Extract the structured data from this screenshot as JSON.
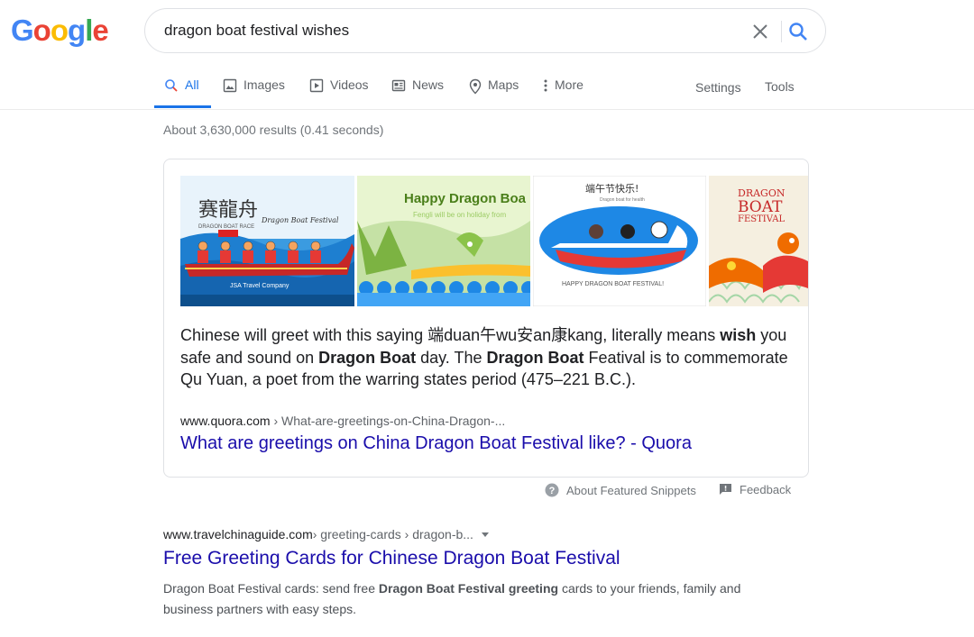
{
  "logo": {
    "letters": [
      "G",
      "o",
      "o",
      "g",
      "l",
      "e"
    ],
    "colors": [
      "#4285F4",
      "#EA4335",
      "#FBBC05",
      "#4285F4",
      "#34A853",
      "#EA4335"
    ]
  },
  "search": {
    "query": "dragon boat festival wishes"
  },
  "tabs": [
    {
      "label": "All",
      "icon": "search-icon",
      "active": true
    },
    {
      "label": "Images",
      "icon": "image-icon"
    },
    {
      "label": "Videos",
      "icon": "video-icon"
    },
    {
      "label": "News",
      "icon": "news-icon"
    },
    {
      "label": "Maps",
      "icon": "map-pin-icon"
    },
    {
      "label": "More",
      "icon": "dots-vertical-icon"
    }
  ],
  "tools": {
    "settings": "Settings",
    "tools": "Tools"
  },
  "stats": "About 3,630,000 results (0.41 seconds)",
  "featured_snippet": {
    "images": [
      {
        "alt_text_main": "赛龍舟",
        "alt_text_sub": "DRAGON BOAT RACE",
        "caption": "Dragon Boat Festival",
        "footer": "JSA Travel Company"
      },
      {
        "heading": "Happy Dragon Boa",
        "subtext": "Fengli will be on holiday from"
      },
      {
        "heading": "端午节快乐!",
        "subtext": "Dragon boat for health",
        "caption": "HAPPY DRAGON BOAT FESTIVAL!"
      },
      {
        "heading_line1": "DRAGON",
        "heading_line2": "BOAT",
        "heading_line3": "FESTIVAL"
      }
    ],
    "text": {
      "p1": "Chinese will greet with this saying 端duan午wu安an康kang, literally means ",
      "b1": "wish",
      "p2": " you safe and sound on ",
      "b2": "Dragon Boat",
      "p3": " day. The ",
      "b3": "Dragon Boat",
      "p4": " Featival is to commemorate Qu Yuan, a poet from the warring states period (475–221 B.C.)."
    },
    "cite_domain": "www.quora.com",
    "cite_path": " › What-are-greetings-on-China-Dragon-...",
    "title": "What are greetings on China Dragon Boat Festival like? - Quora"
  },
  "snippet_footer": {
    "about": "About Featured Snippets",
    "feedback": "Feedback"
  },
  "result": {
    "cite_domain": "www.travelchinaguide.com",
    "cite_path": " › greeting-cards › dragon-b...",
    "title": "Free Greeting Cards for Chinese Dragon Boat Festival",
    "desc": {
      "p1": "Dragon Boat Festival cards: send free ",
      "b1": "Dragon Boat Festival greeting",
      "p2": " cards to your friends, family and business partners with easy steps."
    }
  }
}
